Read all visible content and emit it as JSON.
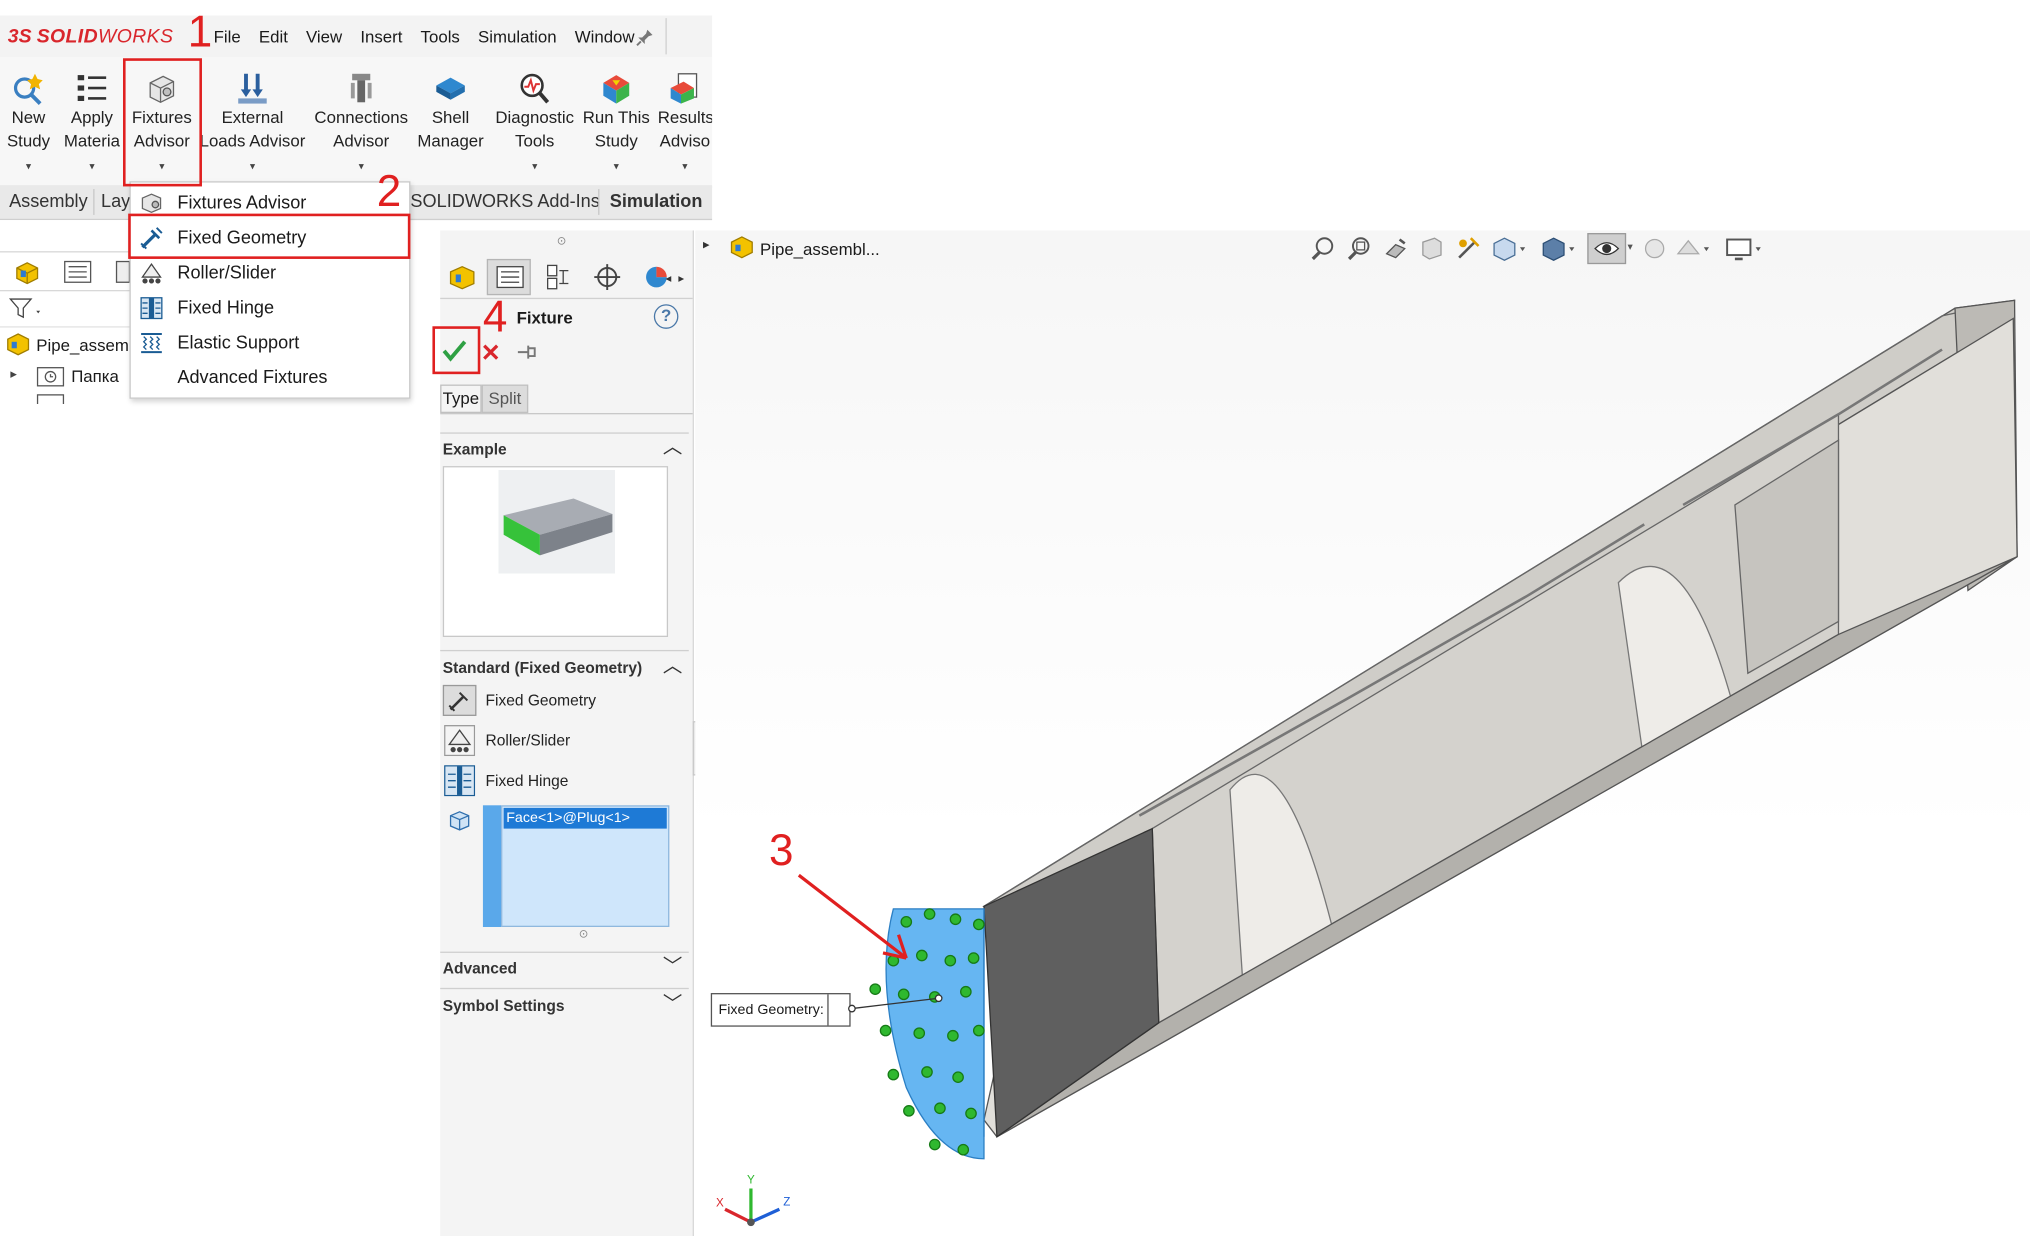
{
  "app": {
    "logo_ds": "3S",
    "logo_solid": "SOLID",
    "logo_works": "WORKS",
    "menu": [
      "File",
      "Edit",
      "View",
      "Insert",
      "Tools",
      "Simulation",
      "Window"
    ]
  },
  "ribbon": {
    "buttons": [
      {
        "line1": "New",
        "line2": "Study",
        "icon": "new-study-icon"
      },
      {
        "line1": "Apply",
        "line2": "Materia",
        "icon": "apply-material-icon"
      },
      {
        "line1": "Fixtures",
        "line2": "Advisor",
        "icon": "fixtures-advisor-icon"
      },
      {
        "line1": "External",
        "line2": "Loads Advisor",
        "icon": "external-loads-icon"
      },
      {
        "line1": "Connections",
        "line2": "Advisor",
        "icon": "connections-advisor-icon"
      },
      {
        "line1": "Shell",
        "line2": "Manager",
        "icon": "shell-manager-icon"
      },
      {
        "line1": "Diagnostic",
        "line2": "Tools",
        "icon": "diagnostic-tools-icon"
      },
      {
        "line1": "Run This",
        "line2": "Study",
        "icon": "run-study-icon"
      },
      {
        "line1": "Results",
        "line2": "Adviso",
        "icon": "results-advisor-icon"
      }
    ]
  },
  "tabs": {
    "assembly": "Assembly",
    "layout": "Lay",
    "addins": "SOLIDWORKS Add-Ins",
    "simulation": "Simulation"
  },
  "dropdown": {
    "items": [
      {
        "label": "Fixtures Advisor",
        "icon": "fixtures-advisor-icon"
      },
      {
        "label": "Fixed Geometry",
        "icon": "fixed-geometry-icon"
      },
      {
        "label": "Roller/Slider",
        "icon": "roller-slider-icon"
      },
      {
        "label": "Fixed Hinge",
        "icon": "fixed-hinge-icon"
      },
      {
        "label": "Elastic Support",
        "icon": "elastic-support-icon"
      },
      {
        "label": "Advanced Fixtures",
        "icon": ""
      }
    ]
  },
  "tree": {
    "root": "Pipe_assem",
    "folder": "Папка"
  },
  "property_manager": {
    "title": "Fixture",
    "help": "?",
    "tab_type": "Type",
    "tab_split": "Split",
    "section_example": "Example",
    "section_standard": "Standard (Fixed Geometry)",
    "options": [
      "Fixed Geometry",
      "Roller/Slider",
      "Fixed Hinge"
    ],
    "selection": "Face<1>@Plug<1>",
    "section_advanced": "Advanced",
    "section_symbol": "Symbol Settings"
  },
  "viewport": {
    "breadcrumb": "Pipe_assembl...",
    "callout": "Fixed Geometry:",
    "axes": {
      "x": "X",
      "y": "Y",
      "z": "Z"
    }
  },
  "annotations": {
    "n1": "1",
    "n2": "2",
    "n3": "3",
    "n4": "4",
    "color": "#e02020"
  },
  "colors": {
    "brand_red": "#d9262c",
    "selection_blue": "#1e7ad6",
    "fixture_green": "#2fb82f",
    "face_blue": "#66b6f2"
  }
}
